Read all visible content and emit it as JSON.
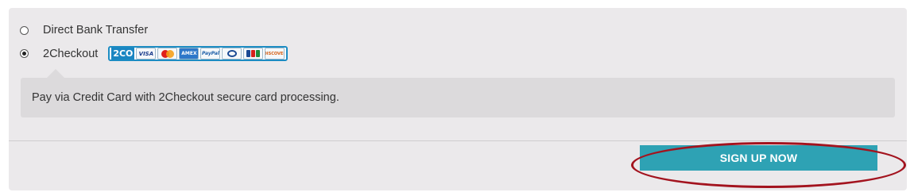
{
  "payment": {
    "options": [
      {
        "label": "Direct Bank Transfer",
        "selected": false
      },
      {
        "label": "2Checkout",
        "selected": true
      }
    ],
    "card_logos": {
      "brand": "2CO",
      "visa": "VISA",
      "mastercard": "mastercard",
      "amex": "AMEX",
      "paypal": "PayPal",
      "diners": "diners",
      "jcb": "JCB",
      "discover": "DISCOVER"
    },
    "description": "Pay via Credit Card with 2Checkout secure card processing."
  },
  "actions": {
    "signup_label": "SIGN UP NOW"
  },
  "colors": {
    "panel_bg": "#ebe9eb",
    "button_bg": "#2ea2b4",
    "highlight_ring": "#a3131e",
    "card_border": "#1c8cc3"
  }
}
